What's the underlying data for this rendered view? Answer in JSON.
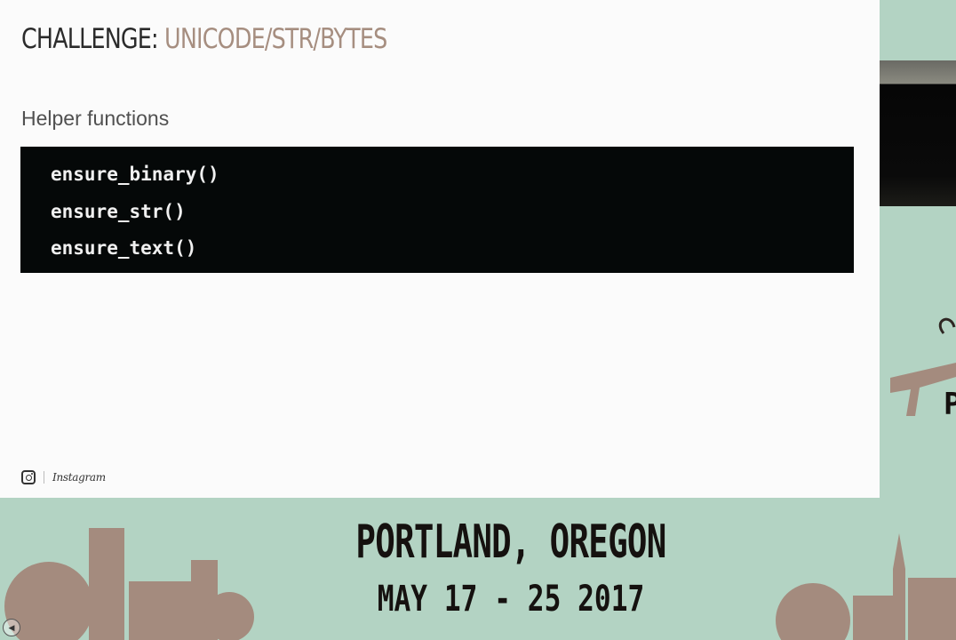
{
  "slide": {
    "title_prefix": "CHALLENGE:",
    "title_accent": "UNICODE/STR/BYTES",
    "subtitle": "Helper functions",
    "code_lines": [
      "ensure_binary()",
      "ensure_str()",
      "ensure_text()"
    ],
    "brand_name": "Instagram"
  },
  "event": {
    "location": "PORTLAND, OREGON",
    "dates": "MAY 17 - 25 2017",
    "partial_logo_letter": "P"
  },
  "icons": {
    "instagram": "instagram-icon",
    "prev": "previous-slide-icon"
  },
  "colors": {
    "slide_bg": "#fbfbfb",
    "accent": "#a68e80",
    "code_bg": "#050808",
    "stage_bg": "#b3d3c3",
    "skyline": "#a48b7e"
  }
}
